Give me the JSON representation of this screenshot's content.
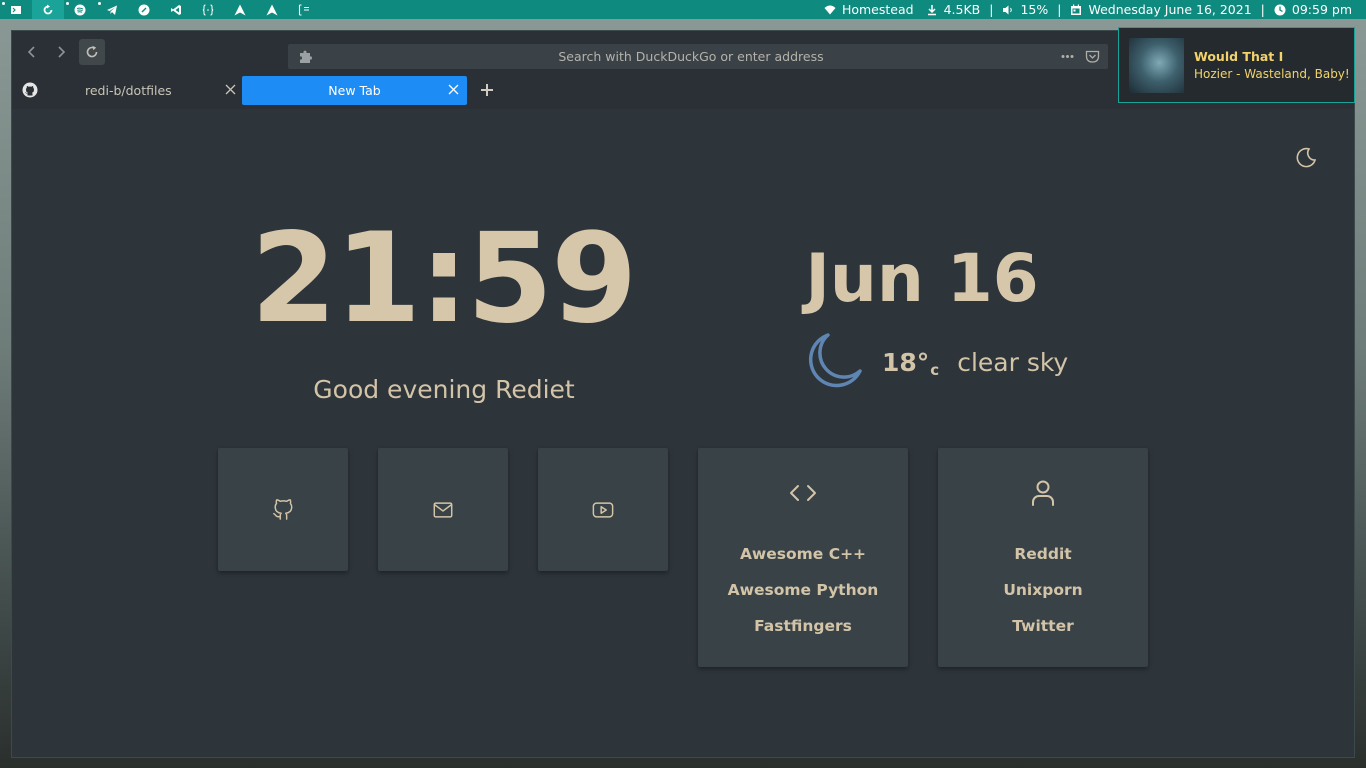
{
  "topbar": {
    "network": "Homestead",
    "download": "4.5KB",
    "volume": "15%",
    "date": "Wednesday June 16, 2021",
    "time": "09:59 pm",
    "separator": "|",
    "workspace_icons": [
      "terminal-icon",
      "refresh-icon",
      "spotify-icon",
      "telegram-icon",
      "firefox-icon",
      "vscode-icon",
      "braces-icon",
      "arch-icon",
      "arch-icon",
      "layout-icon"
    ]
  },
  "browser": {
    "url_placeholder": "Search with DuckDuckGo or enter address",
    "tabs": [
      {
        "label": "redi-b/dotfiles",
        "active": false
      },
      {
        "label": "New Tab",
        "active": true
      }
    ]
  },
  "page": {
    "time": "21:59",
    "greeting": "Good evening Rediet",
    "date": "Jun 16",
    "temperature": "18°",
    "temperature_unit": "c",
    "weather_desc": "clear sky",
    "quick_links": [
      "github-icon",
      "mail-icon",
      "youtube-icon"
    ],
    "cards": [
      {
        "icon": "code-icon",
        "links": [
          "Awesome C++",
          "Awesome Python",
          "Fastfingers"
        ]
      },
      {
        "icon": "user-icon",
        "links": [
          "Reddit",
          "Unixporn",
          "Twitter"
        ]
      }
    ]
  },
  "notification": {
    "title": "Would That I",
    "artist": "Hozier - Wasteland, Baby!"
  },
  "colors": {
    "accent": "#0f8a7f",
    "active_tab": "#1e8cf5",
    "text": "#d3c4a8",
    "page_bg": "#2d343a",
    "card_bg": "#384247",
    "moon": "#5f86b3",
    "notif_text": "#f2d36b"
  }
}
